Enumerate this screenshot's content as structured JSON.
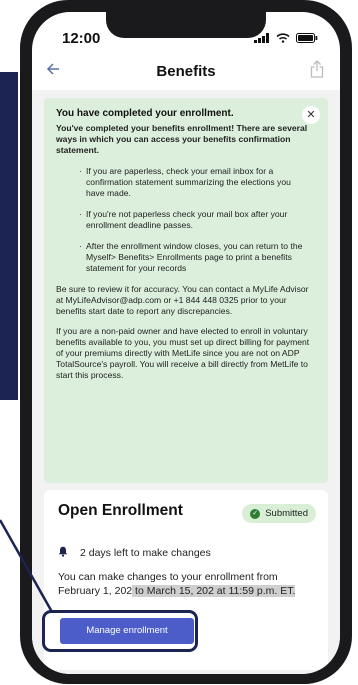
{
  "status_bar": {
    "time": "12:00"
  },
  "header": {
    "title": "Benefits"
  },
  "alert": {
    "title": "You have completed your enrollment.",
    "intro": "You've completed your benefits enrollment! There are several ways in which you can access your benefits confirmation statement.",
    "bullets": [
      "If you are paperless, check your email inbox for a confirmation statement summarizing the elections you have made.",
      "If you're not paperless check your mail box after your enrollment deadline passes.",
      "After the enrollment window closes, you can return to the Myself> Benefits> Enrollments page to print a benefits statement for your records"
    ],
    "review": "Be sure to review it for accuracy. You can contact a MyLife Advisor at MyLifeAdvisor@adp.com or +1 844 448 0325 prior to your benefits start date to report any discrepancies.",
    "nonpaid": "If you are a non-paid owner and have elected to enroll in voluntary benefits available to you, you must set up direct billing for payment of your premiums directly with MetLife since you are not on ADP TotalSource's payroll. You will receive a bill directly from MetLife to start this process."
  },
  "open_enrollment": {
    "title": "Open Enrollment",
    "badge": "Submitted",
    "days_left": "2 days left to make changes",
    "description_parts": [
      "You can make changes to your enrollment from February 1, 202",
      " to March 15, 202",
      " at 11:59 p.m. ET."
    ],
    "button_label": "Manage enrollment"
  },
  "icons": {
    "back": "back-arrow-icon",
    "share": "share-icon",
    "close": "close-icon",
    "bell": "bell-icon",
    "check": "check-circle-icon"
  },
  "colors": {
    "alert_bg": "#dcefdc",
    "button": "#4c5cc8",
    "annotation": "#1b2452",
    "badge_bg": "#d8efd6"
  }
}
